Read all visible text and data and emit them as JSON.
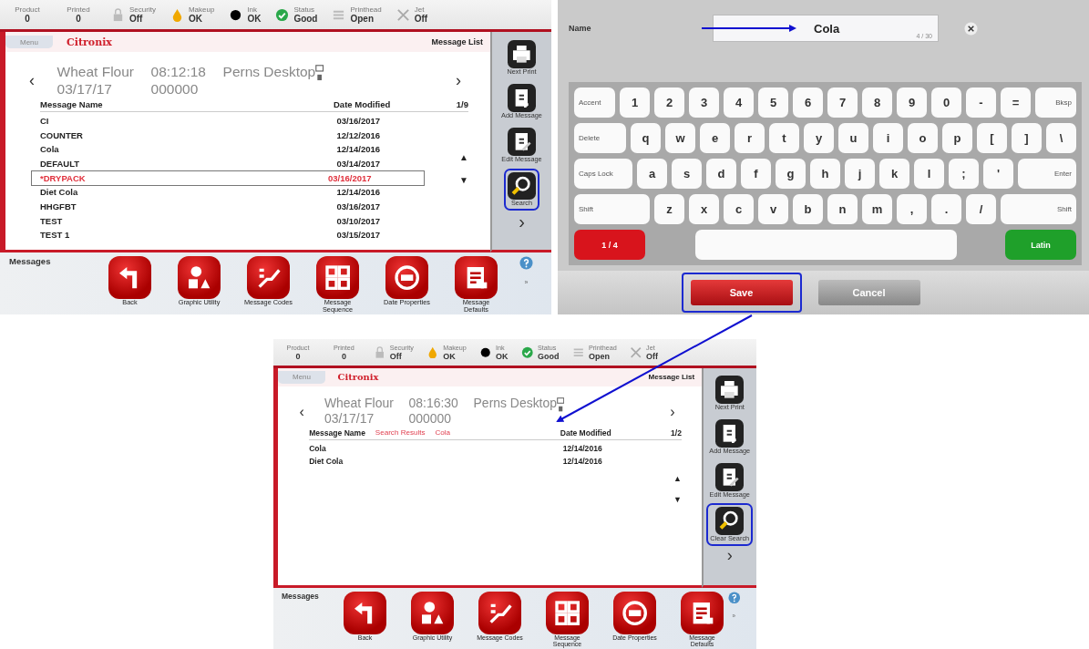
{
  "panels": [
    {
      "kind": "message_list",
      "status": [
        {
          "kind": "counter",
          "label": "Product",
          "value": "0"
        },
        {
          "kind": "counter",
          "label": "Printed",
          "value": "0"
        },
        {
          "kind": "lock",
          "label": "Security",
          "value": "Off"
        },
        {
          "kind": "drop",
          "label": "Makeup",
          "value": "OK"
        },
        {
          "kind": "dot",
          "label": "Ink",
          "value": "OK"
        },
        {
          "kind": "check",
          "label": "Status",
          "value": "Good"
        },
        {
          "kind": "printhead",
          "label": "Printhead",
          "value": "Open"
        },
        {
          "kind": "jet",
          "label": "Jet",
          "value": "Off"
        }
      ],
      "menu_tab": "Menu",
      "logo": "Citronix",
      "title": "Message List",
      "prev": "‹",
      "next": "›",
      "current": {
        "name": "Wheat Flour",
        "time": "08:12:18",
        "printer": "Perns Desktop",
        "date": "03/17/17",
        "count": "000000"
      },
      "columns": {
        "name": "Message Name",
        "date": "Date Modified",
        "page": "1/9"
      },
      "rows": [
        {
          "name": "CI",
          "date": "03/16/2017",
          "selected": false
        },
        {
          "name": "COUNTER",
          "date": "12/12/2016",
          "selected": false
        },
        {
          "name": "Cola",
          "date": "12/14/2016",
          "selected": false
        },
        {
          "name": "DEFAULT",
          "date": "03/14/2017",
          "selected": false
        },
        {
          "name": "*DRYPACK",
          "date": "03/16/2017",
          "selected": true
        },
        {
          "name": "Diet Cola",
          "date": "12/14/2016",
          "selected": false
        },
        {
          "name": "HHGFBT",
          "date": "03/16/2017",
          "selected": false
        },
        {
          "name": "TEST",
          "date": "03/10/2017",
          "selected": false
        },
        {
          "name": "TEST 1",
          "date": "03/15/2017",
          "selected": false
        }
      ],
      "scroll_up": "▲",
      "scroll_down": "▼",
      "side_buttons": [
        {
          "kind": "printer",
          "label": "Next Print",
          "highlighted": false
        },
        {
          "kind": "add",
          "label": "Add Message",
          "highlighted": false
        },
        {
          "kind": "edit",
          "label": "Edit Message",
          "highlighted": false
        },
        {
          "kind": "search",
          "label": "Search",
          "highlighted": true
        }
      ],
      "side_next": "›",
      "footer_title": "Messages",
      "tools": [
        {
          "kind": "back",
          "label": "Back"
        },
        {
          "kind": "shapes",
          "label": "Graphic Utility"
        },
        {
          "kind": "codes",
          "label": "Message Codes"
        },
        {
          "kind": "grid",
          "label": "Message Sequence"
        },
        {
          "kind": "date",
          "label": "Date Properties"
        },
        {
          "kind": "doc",
          "label": "Message Defaults"
        }
      ],
      "footer_more": "»"
    },
    {
      "kind": "keyboard",
      "field_label": "Name",
      "value": "Cola",
      "counter": "4 / 30",
      "key_rows": [
        [
          {
            "kind": "mod_left",
            "label": "Accent"
          },
          {
            "kind": "char",
            "label": "1"
          },
          {
            "kind": "char",
            "label": "2"
          },
          {
            "kind": "char",
            "label": "3"
          },
          {
            "kind": "char",
            "label": "4"
          },
          {
            "kind": "char",
            "label": "5"
          },
          {
            "kind": "char",
            "label": "6"
          },
          {
            "kind": "char",
            "label": "7"
          },
          {
            "kind": "char",
            "label": "8"
          },
          {
            "kind": "char",
            "label": "9"
          },
          {
            "kind": "char",
            "label": "0"
          },
          {
            "kind": "char",
            "label": "-"
          },
          {
            "kind": "char",
            "label": "="
          },
          {
            "kind": "mod_right",
            "label": "Bksp"
          }
        ],
        [
          {
            "kind": "mod_left",
            "label": "Delete"
          },
          {
            "kind": "char",
            "label": "q"
          },
          {
            "kind": "char",
            "label": "w"
          },
          {
            "kind": "char",
            "label": "e"
          },
          {
            "kind": "char",
            "label": "r"
          },
          {
            "kind": "char",
            "label": "t"
          },
          {
            "kind": "char",
            "label": "y"
          },
          {
            "kind": "char",
            "label": "u"
          },
          {
            "kind": "char",
            "label": "i"
          },
          {
            "kind": "char",
            "label": "o"
          },
          {
            "kind": "char",
            "label": "p"
          },
          {
            "kind": "char",
            "label": "["
          },
          {
            "kind": "char",
            "label": "]"
          },
          {
            "kind": "char",
            "label": "\\"
          }
        ],
        [
          {
            "kind": "mod_left",
            "label": "Caps Lock"
          },
          {
            "kind": "char",
            "label": "a"
          },
          {
            "kind": "char",
            "label": "s"
          },
          {
            "kind": "char",
            "label": "d"
          },
          {
            "kind": "char",
            "label": "f"
          },
          {
            "kind": "char",
            "label": "g"
          },
          {
            "kind": "char",
            "label": "h"
          },
          {
            "kind": "char",
            "label": "j"
          },
          {
            "kind": "char",
            "label": "k"
          },
          {
            "kind": "char",
            "label": "l"
          },
          {
            "kind": "char",
            "label": ";"
          },
          {
            "kind": "char",
            "label": "'"
          },
          {
            "kind": "mod_right",
            "label": "Enter"
          }
        ],
        [
          {
            "kind": "mod_left",
            "label": "Shift"
          },
          {
            "kind": "char",
            "label": "z"
          },
          {
            "kind": "char",
            "label": "x"
          },
          {
            "kind": "char",
            "label": "c"
          },
          {
            "kind": "char",
            "label": "v"
          },
          {
            "kind": "char",
            "label": "b"
          },
          {
            "kind": "char",
            "label": "n"
          },
          {
            "kind": "char",
            "label": "m"
          },
          {
            "kind": "char",
            "label": ","
          },
          {
            "kind": "char",
            "label": "."
          },
          {
            "kind": "char",
            "label": "/"
          },
          {
            "kind": "mod_right",
            "label": "Shift"
          }
        ],
        [
          {
            "kind": "red",
            "label": "1 / 4"
          },
          {
            "kind": "space"
          },
          {
            "kind": "green",
            "label": "Latin"
          }
        ]
      ],
      "buttons": [
        {
          "kind": "save",
          "label": "Save",
          "highlighted": true
        },
        {
          "kind": "cancel",
          "label": "Cancel",
          "highlighted": false
        }
      ]
    },
    {
      "kind": "message_list",
      "status": [
        {
          "kind": "counter",
          "label": "Product",
          "value": "0"
        },
        {
          "kind": "counter",
          "label": "Printed",
          "value": "0"
        },
        {
          "kind": "lock",
          "label": "Security",
          "value": "Off"
        },
        {
          "kind": "drop",
          "label": "Makeup",
          "value": "OK"
        },
        {
          "kind": "dot",
          "label": "Ink",
          "value": "OK"
        },
        {
          "kind": "check",
          "label": "Status",
          "value": "Good"
        },
        {
          "kind": "printhead",
          "label": "Printhead",
          "value": "Open"
        },
        {
          "kind": "jet",
          "label": "Jet",
          "value": "Off"
        }
      ],
      "menu_tab": "Menu",
      "logo": "Citronix",
      "title": "Message List",
      "prev": "‹",
      "next": "›",
      "current": {
        "name": "Wheat Flour",
        "time": "08:16:30",
        "printer": "Perns Desktop",
        "date": "03/17/17",
        "count": "000000"
      },
      "columns": {
        "name": "Message Name",
        "date": "Date Modified",
        "page": "1/2"
      },
      "search": {
        "label": "Search Results",
        "term": "Cola"
      },
      "rows": [
        {
          "name": "Cola",
          "date": "12/14/2016",
          "selected": false
        },
        {
          "name": "Diet Cola",
          "date": "12/14/2016",
          "selected": false
        }
      ],
      "scroll_up": "▲",
      "scroll_down": "▼",
      "side_buttons": [
        {
          "kind": "printer",
          "label": "Next Print",
          "highlighted": false
        },
        {
          "kind": "add",
          "label": "Add Message",
          "highlighted": false
        },
        {
          "kind": "edit",
          "label": "Edit Message",
          "highlighted": false
        },
        {
          "kind": "search",
          "label": "Clear Search",
          "highlighted": true
        }
      ],
      "side_next": "›",
      "footer_title": "Messages",
      "tools": [
        {
          "kind": "back",
          "label": "Back"
        },
        {
          "kind": "shapes",
          "label": "Graphic Utility"
        },
        {
          "kind": "codes",
          "label": "Message Codes"
        },
        {
          "kind": "grid",
          "label": "Message Sequence"
        },
        {
          "kind": "date",
          "label": "Date Properties"
        },
        {
          "kind": "doc",
          "label": "Message Defaults"
        }
      ],
      "footer_more": "»"
    }
  ]
}
